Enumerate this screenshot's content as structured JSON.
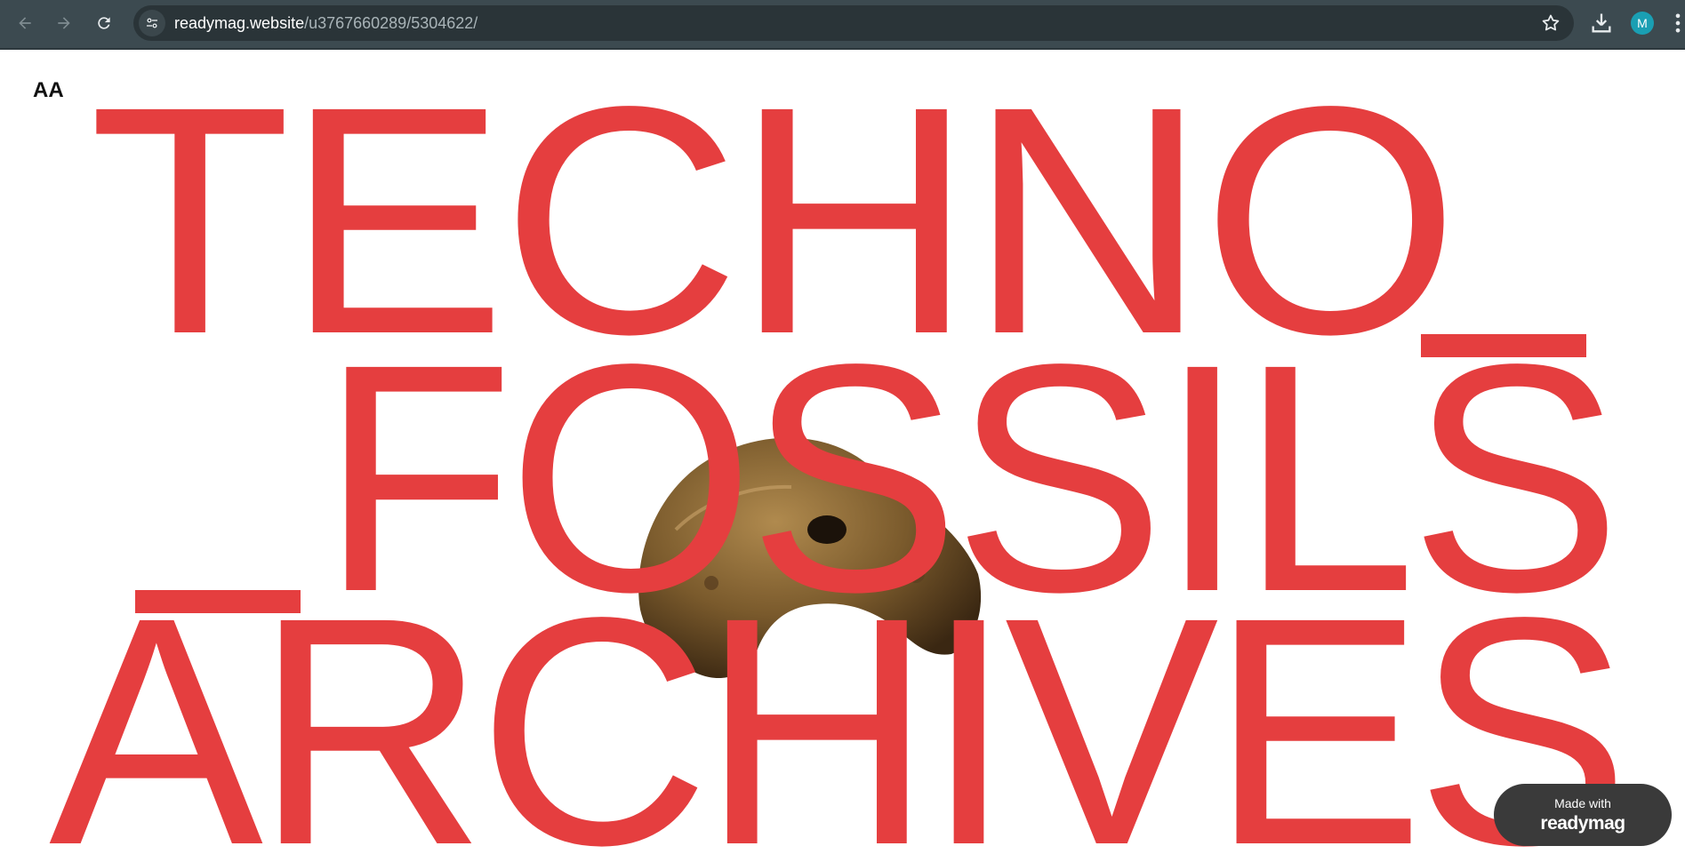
{
  "browser": {
    "url_domain": "readymag.website",
    "url_path": "/u3767660289/5304622/",
    "profile_initial": "M",
    "icons": {
      "back": "arrow-left-icon",
      "forward": "arrow-right-icon",
      "reload": "reload-icon",
      "site_info": "tune-icon",
      "bookmark": "star-icon",
      "download": "download-icon",
      "menu": "kebab-menu-icon"
    }
  },
  "page": {
    "font_toggle": "AA",
    "title_lines": [
      "TECHNO",
      "FOSSILS",
      "ARCHIVES"
    ],
    "accent_color": "#e53e3f",
    "badge": {
      "made_with": "Made with",
      "brand": "readymag"
    }
  }
}
